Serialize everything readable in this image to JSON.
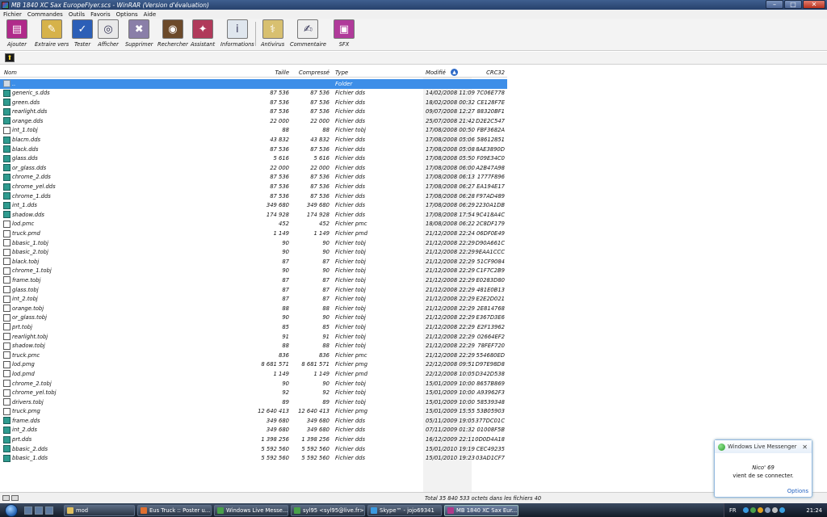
{
  "window": {
    "title": "MB 1840 XC Sax EuropeFlyer.scs - WinRAR (Version d'évaluation)",
    "controls": {
      "minimize": "–",
      "maximize": "□",
      "close": "✕"
    }
  },
  "menu": [
    "Fichier",
    "Commandes",
    "Outils",
    "Favoris",
    "Options",
    "Aide"
  ],
  "toolbar": [
    {
      "label": "Ajouter",
      "icon": "add-books-icon",
      "glyph": "▤",
      "color": "#b02a8a"
    },
    {
      "label": "Extraire vers",
      "icon": "extract-folder-icon",
      "glyph": "✎",
      "color": "#d6b24a"
    },
    {
      "label": "Tester",
      "icon": "test-book-icon",
      "glyph": "✓",
      "color": "#2c5fb7"
    },
    {
      "label": "Afficher",
      "icon": "view-glasses-icon",
      "glyph": "◎",
      "color": "#e9e9e9"
    },
    {
      "label": "Supprimer",
      "icon": "delete-icon",
      "glyph": "✖",
      "color": "#8a7fa8"
    },
    {
      "label": "Rechercher",
      "icon": "binoculars-icon",
      "glyph": "◉",
      "color": "#6c4a2a"
    },
    {
      "label": "Assistant",
      "icon": "wizard-icon",
      "glyph": "✦",
      "color": "#b03a5a"
    },
    {
      "label": "Informations",
      "icon": "info-icon",
      "glyph": "i",
      "color": "#dfe6ee"
    },
    {
      "label": "Antivirus",
      "icon": "antivirus-icon",
      "glyph": "⚕",
      "color": "#d8c070"
    },
    {
      "label": "Commentaire",
      "icon": "comment-icon",
      "glyph": "✍",
      "color": "#eeeeee"
    },
    {
      "label": "SFX",
      "icon": "sfx-icon",
      "glyph": "▣",
      "color": "#b03a9a"
    }
  ],
  "columns": {
    "name": "Nom",
    "size": "Taille",
    "compressed": "Compressé",
    "type": "Type",
    "modified": "Modifié",
    "crc": "CRC32"
  },
  "files": [
    {
      "name": "..",
      "size": "",
      "compressed": "",
      "type": "Folder",
      "modified": "",
      "crc": "",
      "kind": "folder"
    },
    {
      "name": "generic_s.dds",
      "size": "87 536",
      "compressed": "87 536",
      "type": "Fichier dds",
      "modified": "14/02/2008 11:09",
      "crc": "7C06E778",
      "kind": "dds"
    },
    {
      "name": "green.dds",
      "size": "87 536",
      "compressed": "87 536",
      "type": "Fichier dds",
      "modified": "18/02/2008 00:32",
      "crc": "CE128F7E",
      "kind": "dds"
    },
    {
      "name": "rearlight.dds",
      "size": "87 536",
      "compressed": "87 536",
      "type": "Fichier dds",
      "modified": "09/07/2008 12:27",
      "crc": "88320BF1",
      "kind": "dds"
    },
    {
      "name": "orange.dds",
      "size": "22 000",
      "compressed": "22 000",
      "type": "Fichier dds",
      "modified": "25/07/2008 21:42",
      "crc": "D2E2C547",
      "kind": "dds"
    },
    {
      "name": "int_1.tobj",
      "size": "88",
      "compressed": "88",
      "type": "Fichier tobj",
      "modified": "17/08/2008 00:50",
      "crc": "FBF3682A",
      "kind": "tobj"
    },
    {
      "name": "blacm.dds",
      "size": "43 832",
      "compressed": "43 832",
      "type": "Fichier dds",
      "modified": "17/08/2008 05:06",
      "crc": "58612851",
      "kind": "dds"
    },
    {
      "name": "black.dds",
      "size": "87 536",
      "compressed": "87 536",
      "type": "Fichier dds",
      "modified": "17/08/2008 05:08",
      "crc": "8AE3890D",
      "kind": "dds"
    },
    {
      "name": "glass.dds",
      "size": "5 616",
      "compressed": "5 616",
      "type": "Fichier dds",
      "modified": "17/08/2008 05:50",
      "crc": "F09E34C0",
      "kind": "dds"
    },
    {
      "name": "or_glass.dds",
      "size": "22 000",
      "compressed": "22 000",
      "type": "Fichier dds",
      "modified": "17/08/2008 06:00",
      "crc": "A2B47A98",
      "kind": "dds"
    },
    {
      "name": "chrome_2.dds",
      "size": "87 536",
      "compressed": "87 536",
      "type": "Fichier dds",
      "modified": "17/08/2008 06:13",
      "crc": "1777F896",
      "kind": "dds"
    },
    {
      "name": "chrome_yel.dds",
      "size": "87 536",
      "compressed": "87 536",
      "type": "Fichier dds",
      "modified": "17/08/2008 06:27",
      "crc": "EA194E17",
      "kind": "dds"
    },
    {
      "name": "chrome_1.dds",
      "size": "87 536",
      "compressed": "87 536",
      "type": "Fichier dds",
      "modified": "17/08/2008 06:28",
      "crc": "F97AD489",
      "kind": "dds"
    },
    {
      "name": "int_1.dds",
      "size": "349 680",
      "compressed": "349 680",
      "type": "Fichier dds",
      "modified": "17/08/2008 06:29",
      "crc": "2230A1DB",
      "kind": "dds"
    },
    {
      "name": "shadow.dds",
      "size": "174 928",
      "compressed": "174 928",
      "type": "Fichier dds",
      "modified": "17/08/2008 17:54",
      "crc": "9C418A4C",
      "kind": "dds"
    },
    {
      "name": "lod.pmc",
      "size": "452",
      "compressed": "452",
      "type": "Fichier pmc",
      "modified": "18/08/2008 06:22",
      "crc": "2C8DF179",
      "kind": "pmc"
    },
    {
      "name": "truck.pmd",
      "size": "1 149",
      "compressed": "1 149",
      "type": "Fichier pmd",
      "modified": "21/12/2008 22:24",
      "crc": "06DF0E49",
      "kind": "pmd"
    },
    {
      "name": "bbasic_1.tobj",
      "size": "90",
      "compressed": "90",
      "type": "Fichier tobj",
      "modified": "21/12/2008 22:29",
      "crc": "D90A661C",
      "kind": "tobj"
    },
    {
      "name": "bbasic_2.tobj",
      "size": "90",
      "compressed": "90",
      "type": "Fichier tobj",
      "modified": "21/12/2008 22:29",
      "crc": "9EAA1CCC",
      "kind": "tobj"
    },
    {
      "name": "black.tobj",
      "size": "87",
      "compressed": "87",
      "type": "Fichier tobj",
      "modified": "21/12/2008 22:29",
      "crc": "51CF9084",
      "kind": "tobj"
    },
    {
      "name": "chrome_1.tobj",
      "size": "90",
      "compressed": "90",
      "type": "Fichier tobj",
      "modified": "21/12/2008 22:29",
      "crc": "C1F7C2B9",
      "kind": "tobj"
    },
    {
      "name": "frame.tobj",
      "size": "87",
      "compressed": "87",
      "type": "Fichier tobj",
      "modified": "21/12/2008 22:29",
      "crc": "E0283D80",
      "kind": "tobj"
    },
    {
      "name": "glass.tobj",
      "size": "87",
      "compressed": "87",
      "type": "Fichier tobj",
      "modified": "21/12/2008 22:29",
      "crc": "481E0B13",
      "kind": "tobj"
    },
    {
      "name": "int_2.tobj",
      "size": "87",
      "compressed": "87",
      "type": "Fichier tobj",
      "modified": "21/12/2008 22:29",
      "crc": "E2E2D021",
      "kind": "tobj"
    },
    {
      "name": "orange.tobj",
      "size": "88",
      "compressed": "88",
      "type": "Fichier tobj",
      "modified": "21/12/2008 22:29",
      "crc": "2E814768",
      "kind": "tobj"
    },
    {
      "name": "or_glass.tobj",
      "size": "90",
      "compressed": "90",
      "type": "Fichier tobj",
      "modified": "21/12/2008 22:29",
      "crc": "E367D3E6",
      "kind": "tobj"
    },
    {
      "name": "prt.tobj",
      "size": "85",
      "compressed": "85",
      "type": "Fichier tobj",
      "modified": "21/12/2008 22:29",
      "crc": "E2F13962",
      "kind": "tobj"
    },
    {
      "name": "rearlight.tobj",
      "size": "91",
      "compressed": "91",
      "type": "Fichier tobj",
      "modified": "21/12/2008 22:29",
      "crc": "02664EF2",
      "kind": "tobj"
    },
    {
      "name": "shadow.tobj",
      "size": "88",
      "compressed": "88",
      "type": "Fichier tobj",
      "modified": "21/12/2008 22:29",
      "crc": "78FEF720",
      "kind": "tobj"
    },
    {
      "name": "truck.pmc",
      "size": "836",
      "compressed": "836",
      "type": "Fichier pmc",
      "modified": "21/12/2008 22:29",
      "crc": "554680ED",
      "kind": "pmc"
    },
    {
      "name": "lod.pmg",
      "size": "8 681 571",
      "compressed": "8 681 571",
      "type": "Fichier pmg",
      "modified": "22/12/2008 09:51",
      "crc": "D97E98D8",
      "kind": "pmg"
    },
    {
      "name": "lod.pmd",
      "size": "1 149",
      "compressed": "1 149",
      "type": "Fichier pmd",
      "modified": "22/12/2008 10:05",
      "crc": "D342D538",
      "kind": "pmd"
    },
    {
      "name": "chrome_2.tobj",
      "size": "90",
      "compressed": "90",
      "type": "Fichier tobj",
      "modified": "15/01/2009 10:00",
      "crc": "8657B869",
      "kind": "tobj"
    },
    {
      "name": "chrome_yel.tobj",
      "size": "92",
      "compressed": "92",
      "type": "Fichier tobj",
      "modified": "15/01/2009 10:00",
      "crc": "A93962F3",
      "kind": "tobj"
    },
    {
      "name": "drivers.tobj",
      "size": "89",
      "compressed": "89",
      "type": "Fichier tobj",
      "modified": "15/01/2009 10:00",
      "crc": "58539348",
      "kind": "tobj"
    },
    {
      "name": "truck.pmg",
      "size": "12 640 413",
      "compressed": "12 640 413",
      "type": "Fichier pmg",
      "modified": "15/01/2009 15:55",
      "crc": "53B05903",
      "kind": "pmg"
    },
    {
      "name": "frame.dds",
      "size": "349 680",
      "compressed": "349 680",
      "type": "Fichier dds",
      "modified": "05/11/2009 19:05",
      "crc": "377DC01C",
      "kind": "dds"
    },
    {
      "name": "int_2.dds",
      "size": "349 680",
      "compressed": "349 680",
      "type": "Fichier dds",
      "modified": "07/11/2009 01:32",
      "crc": "01008F5B",
      "kind": "dds"
    },
    {
      "name": "prt.dds",
      "size": "1 398 256",
      "compressed": "1 398 256",
      "type": "Fichier dds",
      "modified": "16/12/2009 22:11",
      "crc": "0D0D4A18",
      "kind": "dds"
    },
    {
      "name": "bbasic_2.dds",
      "size": "5 592 560",
      "compressed": "5 592 560",
      "type": "Fichier dds",
      "modified": "15/01/2010 19:19",
      "crc": "CEC49235",
      "kind": "dds"
    },
    {
      "name": "bbasic_1.dds",
      "size": "5 592 560",
      "compressed": "5 592 560",
      "type": "Fichier dds",
      "modified": "15/01/2010 19:23",
      "crc": "03AD1CF7",
      "kind": "dds"
    }
  ],
  "status": {
    "text": "Total 35 840 533 octets dans les fichiers 40"
  },
  "messenger": {
    "title": "Windows Live Messenger",
    "contact": "Nico' 69",
    "message": "vient de se connecter.",
    "options": "Options",
    "close": "✕"
  },
  "taskbar": {
    "tasks": [
      {
        "label": "mod",
        "color": "#e0c060",
        "width": 88
      },
      {
        "label": "Eus Truck :: Poster u...",
        "color": "#e07030",
        "width": 92
      },
      {
        "label": "Windows Live Messe...",
        "color": "#4aa04a",
        "width": 92
      },
      {
        "label": "syl95 <syl95@live.fr>",
        "color": "#4aa04a",
        "width": 92
      },
      {
        "label": "Skype™ - jojo69341",
        "color": "#3a9ae0",
        "width": 92
      },
      {
        "label": "MB 1840 XC Sax Eur...",
        "color": "#b03a8a",
        "width": 92,
        "active": true
      }
    ],
    "language": "FR",
    "clock": "21:24"
  }
}
